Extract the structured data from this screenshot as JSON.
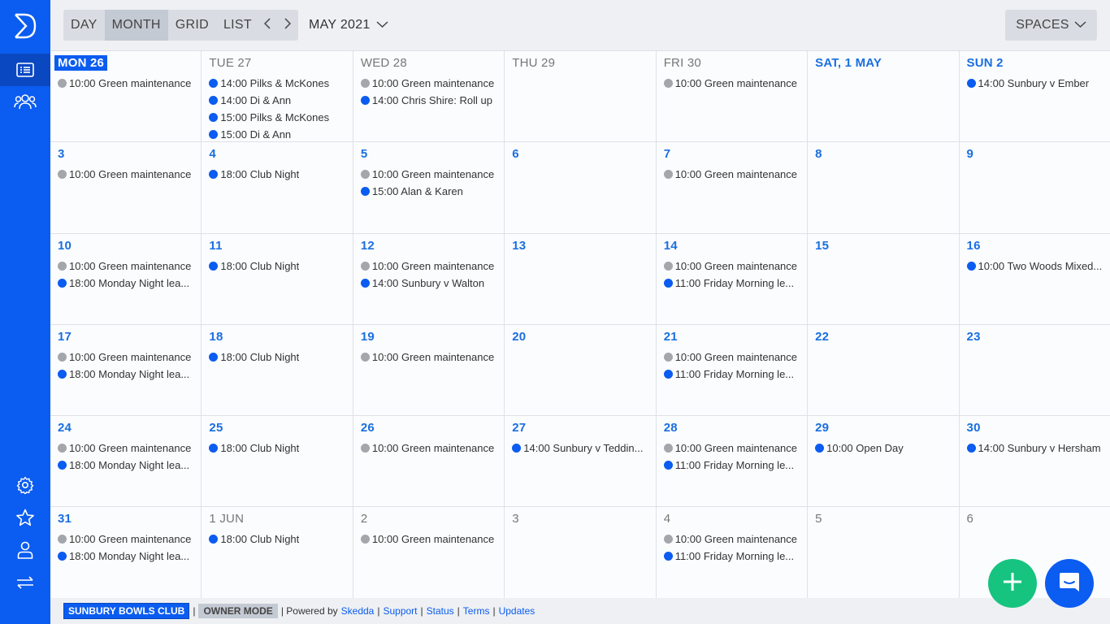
{
  "toolbar": {
    "views": [
      "DAY",
      "MONTH",
      "GRID",
      "LIST"
    ],
    "active_view": "MONTH",
    "month_label": "MAY 2021",
    "spaces_label": "SPACES"
  },
  "calendar": {
    "weeks": [
      [
        {
          "label": "MON 26",
          "style": "today",
          "events": [
            {
              "text": "10:00 Green maintenance",
              "color": "grey"
            }
          ]
        },
        {
          "label": "TUE 27",
          "style": "muted",
          "events": [
            {
              "text": "14:00 Pilks & McKones",
              "color": "blue"
            },
            {
              "text": "14:00 Di & Ann",
              "color": "blue"
            },
            {
              "text": "15:00 Pilks & McKones",
              "color": "blue"
            },
            {
              "text": "15:00 Di & Ann",
              "color": "blue"
            }
          ]
        },
        {
          "label": "WED 28",
          "style": "muted",
          "events": [
            {
              "text": "10:00 Green maintenance",
              "color": "grey"
            },
            {
              "text": "14:00 Chris Shire: Roll up",
              "color": "blue"
            }
          ]
        },
        {
          "label": "THU 29",
          "style": "muted",
          "events": []
        },
        {
          "label": "FRI 30",
          "style": "muted",
          "events": [
            {
              "text": "10:00 Green maintenance",
              "color": "grey"
            }
          ]
        },
        {
          "label": "SAT, 1 MAY",
          "style": "bold",
          "events": []
        },
        {
          "label": "SUN 2",
          "style": "bold",
          "events": [
            {
              "text": "14:00 Sunbury v Ember",
              "color": "blue"
            }
          ]
        }
      ],
      [
        {
          "label": "3",
          "style": "bold",
          "events": [
            {
              "text": "10:00 Green maintenance",
              "color": "grey"
            }
          ]
        },
        {
          "label": "4",
          "style": "bold",
          "events": [
            {
              "text": "18:00 Club Night",
              "color": "blue"
            }
          ]
        },
        {
          "label": "5",
          "style": "bold",
          "events": [
            {
              "text": "10:00 Green maintenance",
              "color": "grey"
            },
            {
              "text": "15:00 Alan & Karen",
              "color": "blue"
            }
          ]
        },
        {
          "label": "6",
          "style": "bold",
          "events": []
        },
        {
          "label": "7",
          "style": "bold",
          "events": [
            {
              "text": "10:00 Green maintenance",
              "color": "grey"
            }
          ]
        },
        {
          "label": "8",
          "style": "bold",
          "events": []
        },
        {
          "label": "9",
          "style": "bold",
          "events": []
        }
      ],
      [
        {
          "label": "10",
          "style": "bold",
          "events": [
            {
              "text": "10:00 Green maintenance",
              "color": "grey"
            },
            {
              "text": "18:00 Monday Night lea...",
              "color": "blue"
            }
          ]
        },
        {
          "label": "11",
          "style": "bold",
          "events": [
            {
              "text": "18:00 Club Night",
              "color": "blue"
            }
          ]
        },
        {
          "label": "12",
          "style": "bold",
          "events": [
            {
              "text": "10:00 Green maintenance",
              "color": "grey"
            },
            {
              "text": "14:00 Sunbury v Walton",
              "color": "blue"
            }
          ]
        },
        {
          "label": "13",
          "style": "bold",
          "events": []
        },
        {
          "label": "14",
          "style": "bold",
          "events": [
            {
              "text": "10:00 Green maintenance",
              "color": "grey"
            },
            {
              "text": "11:00 Friday Morning le...",
              "color": "blue"
            }
          ]
        },
        {
          "label": "15",
          "style": "bold",
          "events": []
        },
        {
          "label": "16",
          "style": "bold",
          "events": [
            {
              "text": "10:00 Two Woods Mixed...",
              "color": "blue"
            }
          ]
        }
      ],
      [
        {
          "label": "17",
          "style": "bold",
          "events": [
            {
              "text": "10:00 Green maintenance",
              "color": "grey"
            },
            {
              "text": "18:00 Monday Night lea...",
              "color": "blue"
            }
          ]
        },
        {
          "label": "18",
          "style": "bold",
          "events": [
            {
              "text": "18:00 Club Night",
              "color": "blue"
            }
          ]
        },
        {
          "label": "19",
          "style": "bold",
          "events": [
            {
              "text": "10:00 Green maintenance",
              "color": "grey"
            }
          ]
        },
        {
          "label": "20",
          "style": "bold",
          "events": []
        },
        {
          "label": "21",
          "style": "bold",
          "events": [
            {
              "text": "10:00 Green maintenance",
              "color": "grey"
            },
            {
              "text": "11:00 Friday Morning le...",
              "color": "blue"
            }
          ]
        },
        {
          "label": "22",
          "style": "bold",
          "events": []
        },
        {
          "label": "23",
          "style": "bold",
          "events": []
        }
      ],
      [
        {
          "label": "24",
          "style": "bold",
          "events": [
            {
              "text": "10:00 Green maintenance",
              "color": "grey"
            },
            {
              "text": "18:00 Monday Night lea...",
              "color": "blue"
            }
          ]
        },
        {
          "label": "25",
          "style": "bold",
          "events": [
            {
              "text": "18:00 Club Night",
              "color": "blue"
            }
          ]
        },
        {
          "label": "26",
          "style": "bold",
          "events": [
            {
              "text": "10:00 Green maintenance",
              "color": "grey"
            }
          ]
        },
        {
          "label": "27",
          "style": "bold",
          "events": [
            {
              "text": "14:00 Sunbury v Teddin...",
              "color": "blue"
            }
          ]
        },
        {
          "label": "28",
          "style": "bold",
          "events": [
            {
              "text": "10:00 Green maintenance",
              "color": "grey"
            },
            {
              "text": "11:00 Friday Morning le...",
              "color": "blue"
            }
          ]
        },
        {
          "label": "29",
          "style": "bold",
          "events": [
            {
              "text": "10:00 Open Day",
              "color": "blue"
            }
          ]
        },
        {
          "label": "30",
          "style": "bold",
          "events": [
            {
              "text": "14:00 Sunbury v Hersham",
              "color": "blue"
            }
          ]
        }
      ],
      [
        {
          "label": "31",
          "style": "bold",
          "events": [
            {
              "text": "10:00 Green maintenance",
              "color": "grey"
            },
            {
              "text": "18:00 Monday Night lea...",
              "color": "blue"
            }
          ]
        },
        {
          "label": "1 JUN",
          "style": "muted",
          "events": [
            {
              "text": "18:00 Club Night",
              "color": "blue"
            }
          ]
        },
        {
          "label": "2",
          "style": "muted",
          "events": [
            {
              "text": "10:00 Green maintenance",
              "color": "grey"
            }
          ]
        },
        {
          "label": "3",
          "style": "muted",
          "events": []
        },
        {
          "label": "4",
          "style": "muted",
          "events": [
            {
              "text": "10:00 Green maintenance",
              "color": "grey"
            },
            {
              "text": "11:00 Friday Morning le...",
              "color": "blue"
            }
          ]
        },
        {
          "label": "5",
          "style": "muted",
          "events": []
        },
        {
          "label": "6",
          "style": "muted",
          "events": []
        }
      ]
    ]
  },
  "footer": {
    "org_name": "SUNBURY BOWLS CLUB",
    "mode": "OWNER MODE",
    "powered_prefix": "| Powered by",
    "powered_link": "Skedda",
    "links": [
      "Support",
      "Status",
      "Terms",
      "Updates"
    ]
  },
  "icons": {
    "logo": "skedda-logo-icon",
    "nav": [
      "list-view-icon",
      "users-icon",
      "settings-icon",
      "star-icon",
      "user-icon",
      "switch-icon"
    ],
    "fabs": [
      "plus-icon",
      "chat-icon"
    ]
  },
  "colors": {
    "brand": "#0b5cf0",
    "add": "#16c47f",
    "event_grey": "#a3a6ab",
    "event_blue": "#0b5cf0"
  }
}
